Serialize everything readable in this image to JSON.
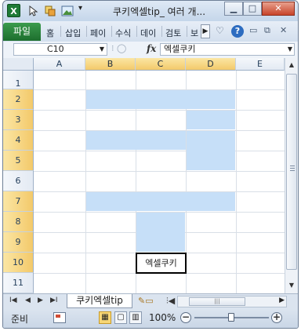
{
  "window": {
    "title": "쿠키엑셀tip_ 여러 개...",
    "min_symbol": "▁",
    "max_symbol": "□",
    "close_symbol": "✕"
  },
  "ribbon": {
    "file_tab": "파일",
    "tabs": [
      "홈",
      "삽입",
      "페이",
      "수식",
      "데이",
      "검토",
      "보"
    ],
    "scroll_symbol": "▶",
    "options_symbol": "♡",
    "help_symbol": "?"
  },
  "formula_bar": {
    "name_box": "C10",
    "fx_label": "fx",
    "formula": "엑셀쿠키"
  },
  "sheet": {
    "columns": [
      "A",
      "B",
      "C",
      "D",
      "E"
    ],
    "rows": [
      "1",
      "2",
      "3",
      "4",
      "5",
      "6",
      "7",
      "8",
      "9",
      "10",
      "11"
    ],
    "active_cell_text": "엑셀쿠키",
    "fill_color": "#c6dff8",
    "header_highlight_color": "#f8d776"
  },
  "sheet_tabs": {
    "active_tab": "쿠키엑셀tip"
  },
  "status_bar": {
    "ready": "준비",
    "zoom": "100%",
    "zoom_out": "−",
    "zoom_in": "+"
  }
}
